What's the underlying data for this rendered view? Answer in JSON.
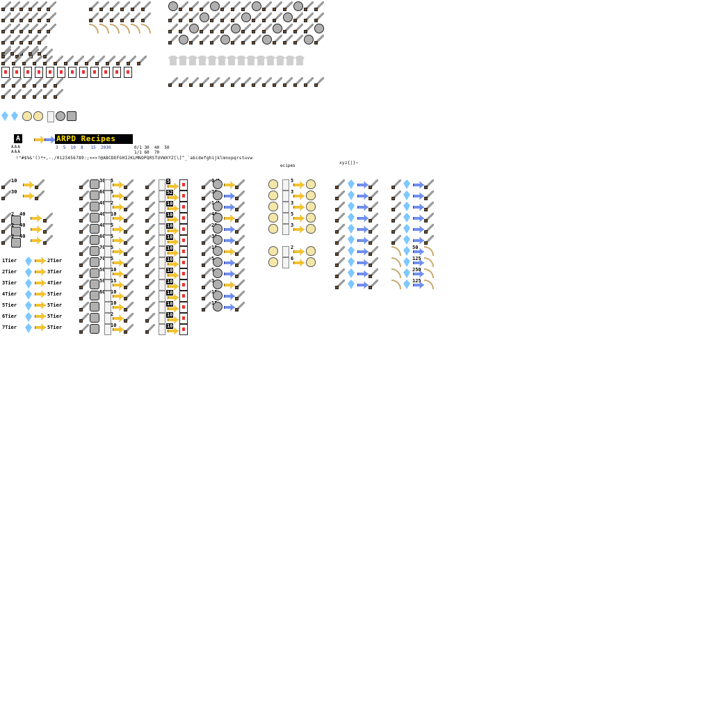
{
  "header": {
    "glyph": "A",
    "title": "ARPD Recipes",
    "mini_rows": [
      "AAA",
      "AAA"
    ],
    "digit_row_1": "3  5  10  8   15  2030",
    "digit_row_2": "0/1 30  40  50",
    "digit_row_3": "1/1 60  70",
    "charset_line": "!\"#$%&'()*+,-./0123456789:;<=>?@ABCDEFGHIJKLMNOPQRSTUVWXYZ[\\]^_`abcdefghijklmnopqrstuvw",
    "charset_cont": "xyz{|}~",
    "charset_sub": "ecipes"
  },
  "tiers": [
    {
      "from": "1Tier",
      "to": "2Tier"
    },
    {
      "from": "2Tier",
      "to": "3Tier"
    },
    {
      "from": "3Tier",
      "to": "4Tier"
    },
    {
      "from": "4Tier",
      "to": "5Tier"
    },
    {
      "from": "5Tier",
      "to": "5Tier"
    },
    {
      "from": "6Tier",
      "to": "5Tier"
    },
    {
      "from": "7Tier",
      "to": "5Tier"
    }
  ],
  "col1_counts": [
    "10",
    "30",
    "40",
    "40",
    "40"
  ],
  "col1_small": [
    "2",
    "2",
    "2"
  ],
  "col2_counts": [
    "30",
    "60",
    "40",
    "40",
    "40",
    "60",
    "70",
    "70",
    "50",
    "50",
    "60"
  ],
  "col2_small": [
    "5",
    "5",
    "2",
    "10",
    "5",
    "5",
    "5",
    "5",
    "10",
    "15",
    "10",
    "10",
    "2",
    "10",
    "15",
    "10",
    "20"
  ],
  "col3_counts": [
    "5",
    "52",
    "10",
    "10",
    "10",
    "10",
    "10",
    "10",
    "10",
    "10",
    "10",
    "10",
    "10",
    "10",
    "10",
    "10"
  ],
  "col4_counts": [
    "0/1",
    "30",
    "1/1",
    "40",
    "20",
    "30",
    "15",
    "5",
    "5",
    "3",
    "15",
    "15",
    "3"
  ],
  "col5_counts": [
    "5",
    "3",
    "3",
    "5",
    "3",
    "3",
    "2",
    "6",
    "10",
    "1"
  ],
  "col7_counts": [
    "50",
    "125",
    "250",
    "125"
  ],
  "colors": {
    "arrow_yellow": "#f2c230",
    "arrow_blue": "#6f8ff0",
    "gem_blue": "#7ec8ff",
    "gem_orange": "#f39a2a",
    "banner_text": "#ffe000",
    "digits": "#1a2d8c"
  }
}
